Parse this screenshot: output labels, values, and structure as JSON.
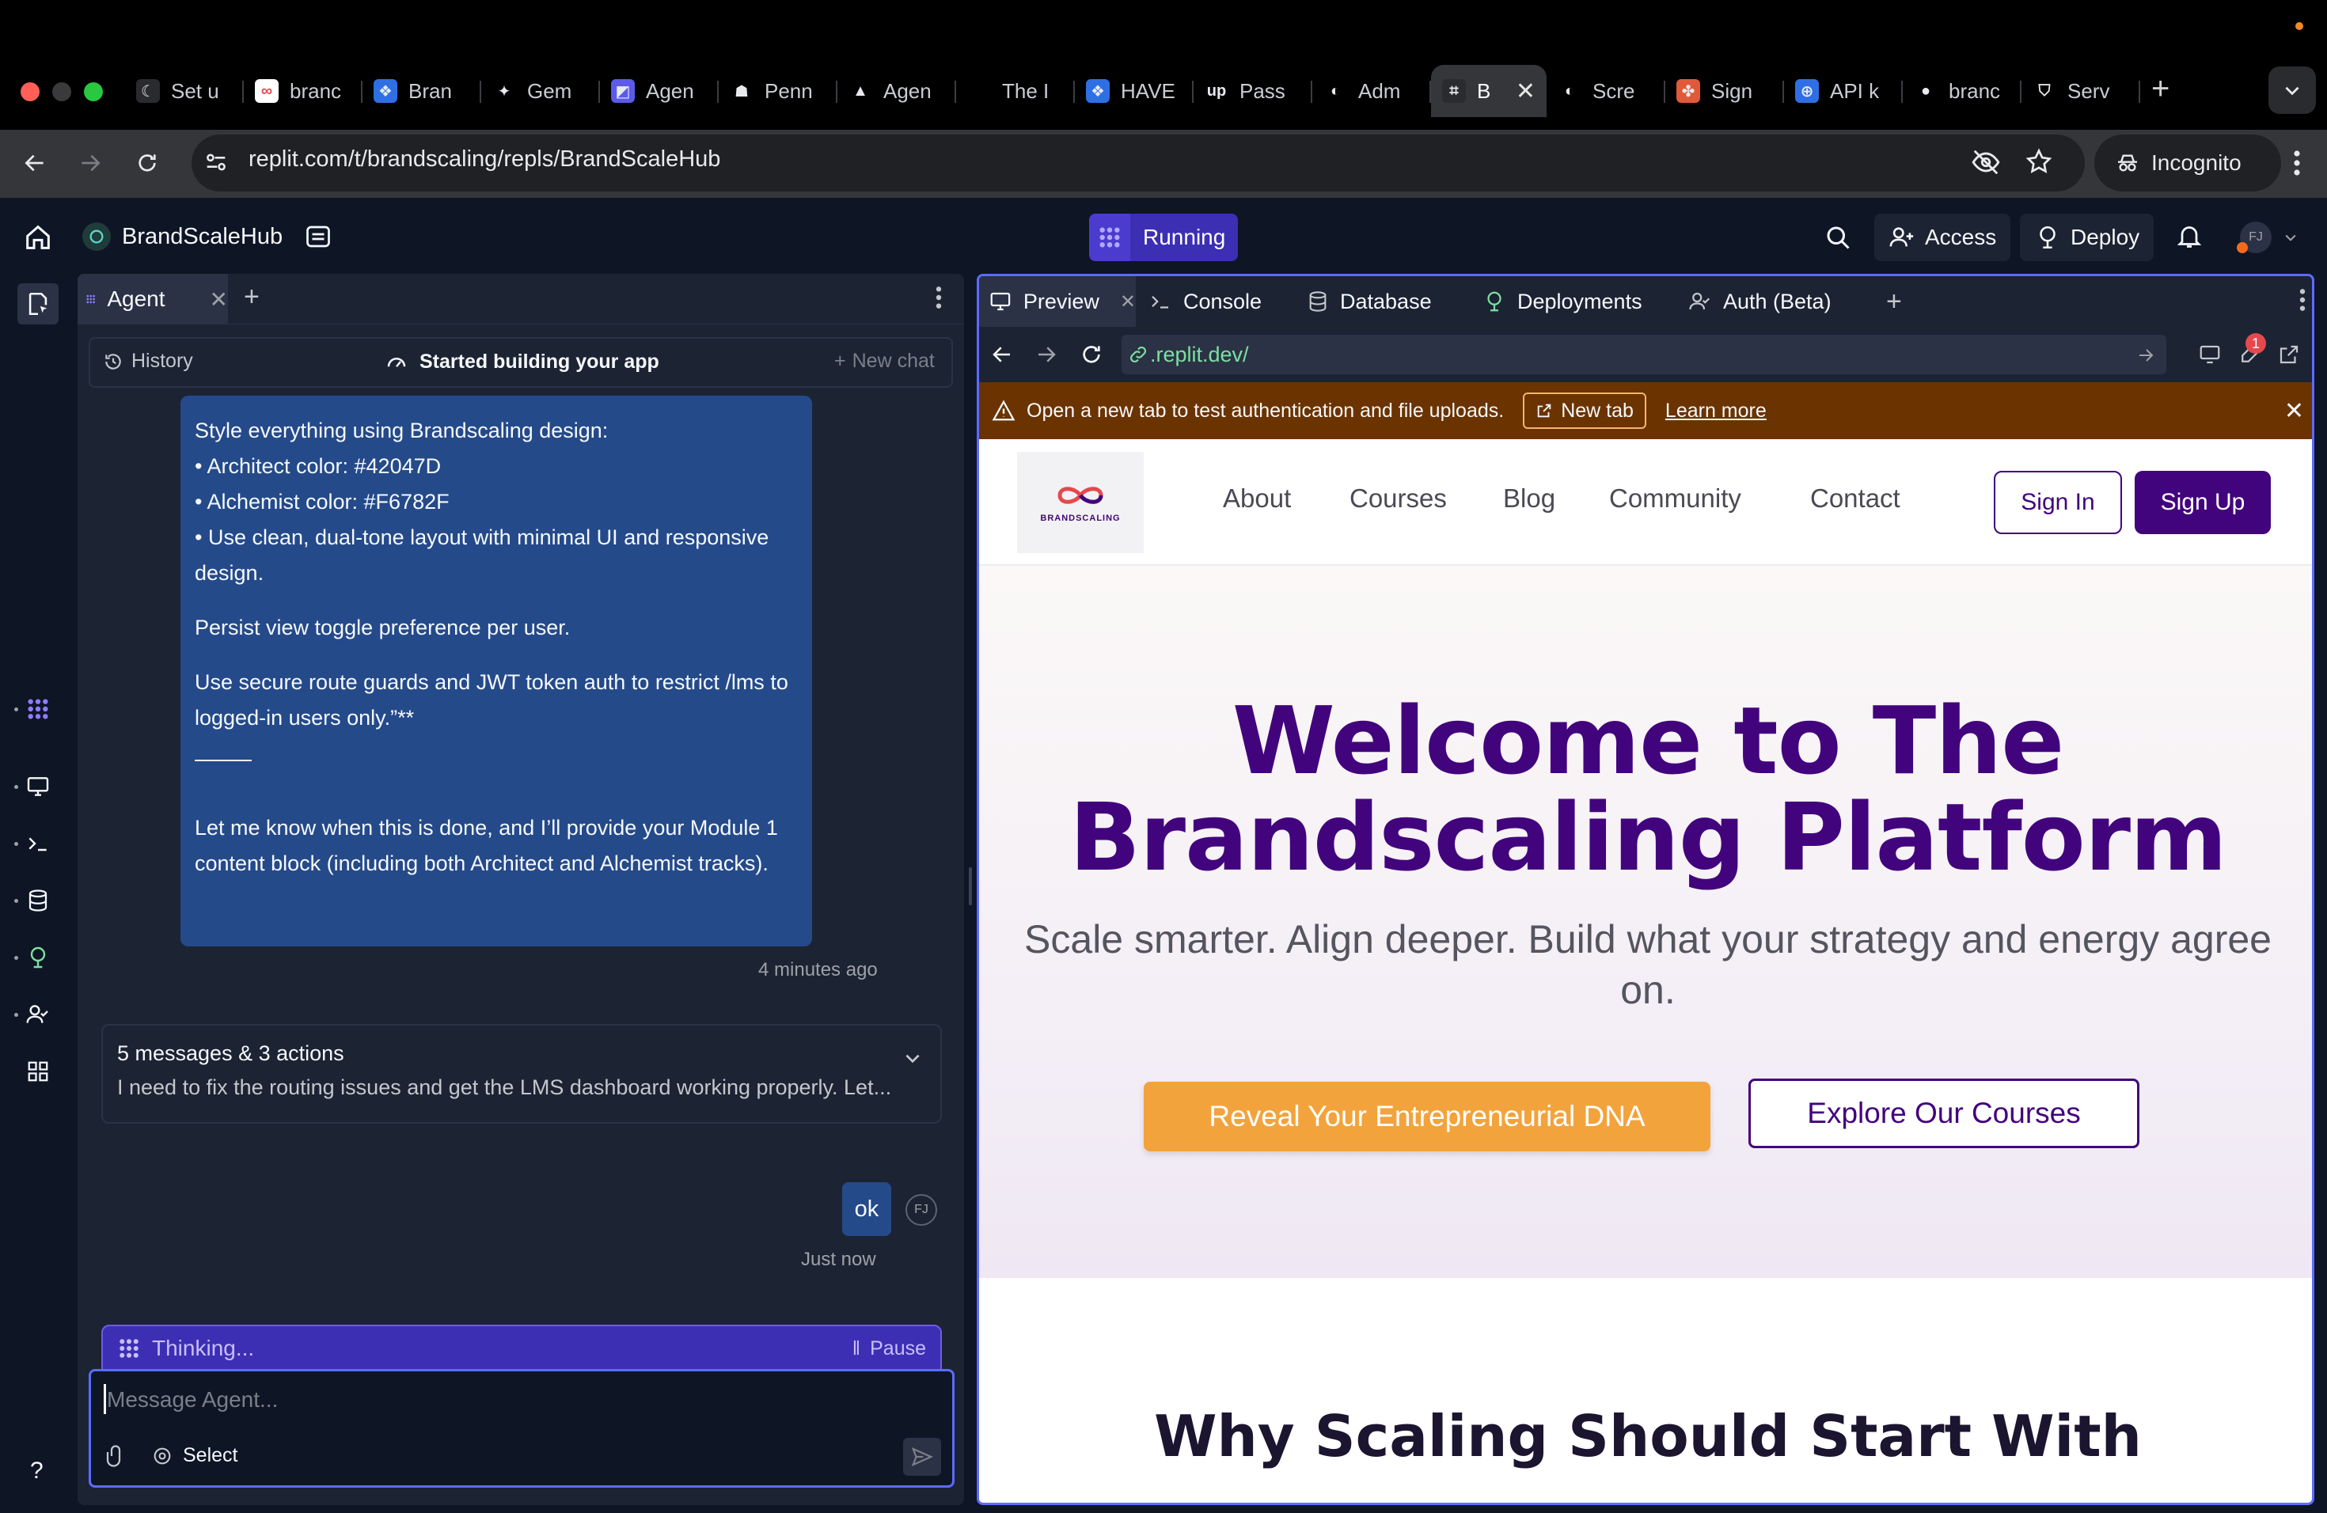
{
  "browser": {
    "tabs": [
      {
        "title": "Set u",
        "fav_color": "#2a2b2e",
        "fav_text": "☾"
      },
      {
        "title": "branc",
        "fav_color": "#ffffff",
        "fav_text": "∞"
      },
      {
        "title": "Bran",
        "fav_color": "#2f6fe4",
        "fav_text": "❖"
      },
      {
        "title": "Gem",
        "fav_color": "#000000",
        "fav_text": "✦"
      },
      {
        "title": "Agen",
        "fav_color": "#5b5be8",
        "fav_text": "◩"
      },
      {
        "title": "Penn",
        "fav_color": "#000000",
        "fav_text": "☗"
      },
      {
        "title": "Agen",
        "fav_color": "#000000",
        "fav_text": "▲"
      },
      {
        "title": "The I",
        "fav_color": "#000000",
        "fav_text": ""
      },
      {
        "title": "HAVE",
        "fav_color": "#2f6fe4",
        "fav_text": "❖"
      },
      {
        "title": "Pass",
        "fav_color": "#000000",
        "fav_text": "up"
      },
      {
        "title": "Adm",
        "fav_color": "#000000",
        "fav_text": "◐"
      },
      {
        "title": "B",
        "fav_color": "#2a2b2e",
        "fav_text": "⌗",
        "active": true
      },
      {
        "title": "Scre",
        "fav_color": "#000000",
        "fav_text": "◐"
      },
      {
        "title": "Sign",
        "fav_color": "#e05a3a",
        "fav_text": "✤"
      },
      {
        "title": "API k",
        "fav_color": "#2f6fe4",
        "fav_text": "⊕"
      },
      {
        "title": "branc",
        "fav_color": "#000000",
        "fav_text": "●"
      },
      {
        "title": "Serv",
        "fav_color": "#000000",
        "fav_text": "⛉"
      }
    ],
    "url": "replit.com/t/brandscaling/repls/BrandScaleHub",
    "incognito_label": "Incognito"
  },
  "replit": {
    "repl_name": "BrandScaleHub",
    "run_status": "Running",
    "access_label": "Access",
    "deploy_label": "Deploy",
    "avatar_initials": "FJ"
  },
  "agent": {
    "tab_label": "Agent",
    "history_label": "History",
    "status_label": "Started building your app",
    "new_chat_label": "New chat",
    "user_message": {
      "l1": "Style everything using Brandscaling design:",
      "l2": "• Architect color: #42047D",
      "l3": "• Alchemist color: #F6782F",
      "l4": "• Use clean, dual-tone layout with minimal UI and responsive design.",
      "p2": "Persist view toggle preference per user.",
      "p3": "Use secure route guards and JWT token auth to restrict /lms to logged-in users only.”**",
      "p4": "Let me know when this is done, and I’ll provide your Module 1 content block (including both Architect and Alchemist tracks)."
    },
    "msg_time": "4 minutes ago",
    "summary_title": "5 messages & 3 actions",
    "summary_preview": "I need to fix the routing issues and get the LMS dashboard working properly. Let...",
    "reply_text": "ok",
    "reply_initials": "FJ",
    "reply_time": "Just now",
    "thinking_label": "Thinking...",
    "pause_label": "Pause",
    "composer_placeholder": "Message Agent...",
    "select_label": "Select"
  },
  "preview": {
    "tabs": {
      "preview": "Preview",
      "console": "Console",
      "database": "Database",
      "deployments": "Deployments",
      "auth": "Auth (Beta)"
    },
    "address": ".replit.dev/",
    "badge_count": "1",
    "warning_text": "Open a new tab to test authentication and file uploads.",
    "new_tab_label": "New tab",
    "learn_more_label": "Learn more",
    "colors": {
      "architect": "#42047D",
      "alchemist": "#F6782F"
    }
  },
  "site": {
    "logo_text": "BRANDSCALING",
    "nav": [
      "About",
      "Courses",
      "Blog",
      "Community",
      "Contact"
    ],
    "sign_in": "Sign In",
    "sign_up": "Sign Up",
    "hero_title_line1": "Welcome to The",
    "hero_title_line2": "Brandscaling Platform",
    "hero_subtitle": "Scale smarter. Align deeper. Build what your strategy and energy agree on.",
    "cta_primary": "Reveal Your Entrepreneurial DNA",
    "cta_secondary": "Explore Our Courses",
    "section_title": "Why Scaling Should Start With"
  }
}
